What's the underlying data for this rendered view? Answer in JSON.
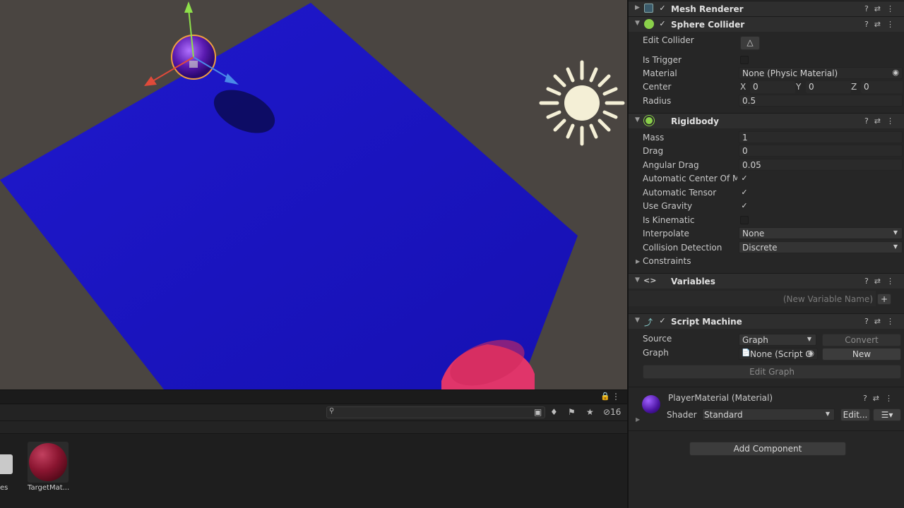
{
  "inspector": {
    "mesh_renderer": {
      "title": "Mesh Renderer"
    },
    "sphere_collider": {
      "title": "Sphere Collider",
      "edit_collider_label": "Edit Collider",
      "is_trigger_label": "Is Trigger",
      "material_label": "Material",
      "material_value": "None (Physic Material)",
      "center_label": "Center",
      "center": {
        "x_label": "X",
        "x": "0",
        "y_label": "Y",
        "y": "0",
        "z_label": "Z",
        "z": "0"
      },
      "radius_label": "Radius",
      "radius_value": "0.5"
    },
    "rigidbody": {
      "title": "Rigidbody",
      "mass_label": "Mass",
      "mass_value": "1",
      "drag_label": "Drag",
      "drag_value": "0",
      "angular_drag_label": "Angular Drag",
      "angular_drag_value": "0.05",
      "auto_center_label": "Automatic Center Of Mas",
      "auto_tensor_label": "Automatic Tensor",
      "use_gravity_label": "Use Gravity",
      "is_kinematic_label": "Is Kinematic",
      "interpolate_label": "Interpolate",
      "interpolate_value": "None",
      "collision_label": "Collision Detection",
      "collision_value": "Discrete",
      "constraints_label": "Constraints"
    },
    "variables": {
      "title": "Variables",
      "icon_glyph": "<>",
      "new_var_placeholder": "(New Variable Name)",
      "add_glyph": "+"
    },
    "script_machine": {
      "title": "Script Machine",
      "source_label": "Source",
      "source_value": "Graph",
      "convert_label": "Convert",
      "graph_label": "Graph",
      "graph_value": "None (Script G",
      "new_label": "New",
      "edit_graph_label": "Edit Graph"
    },
    "material": {
      "title": "PlayerMaterial (Material)",
      "shader_label": "Shader",
      "shader_value": "Standard",
      "edit_label": "Edit..."
    },
    "add_component_label": "Add Component"
  },
  "project": {
    "hidden_count": "16",
    "assets": [
      {
        "label": "es"
      },
      {
        "label": "TargetMat..."
      }
    ]
  },
  "colors": {
    "scene_bg": "#4a4541",
    "plane": "#1a14c4",
    "accent_check": "#d8d8d8",
    "sun": "#f4efd6"
  }
}
